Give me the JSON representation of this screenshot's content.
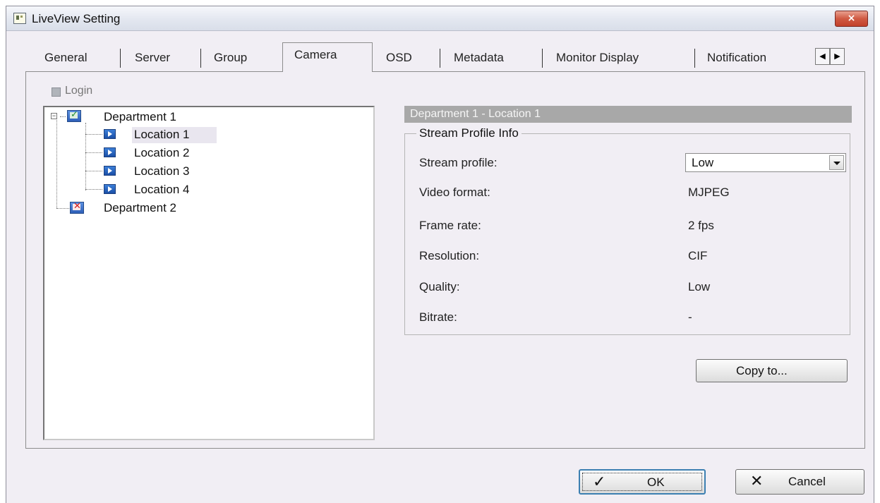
{
  "window": {
    "title": "LiveView Setting",
    "close_symbol": "×"
  },
  "tabs": [
    {
      "label": "General"
    },
    {
      "label": "Server"
    },
    {
      "label": "Group"
    },
    {
      "label": "Camera",
      "active": true
    },
    {
      "label": "OSD"
    },
    {
      "label": "Metadata"
    },
    {
      "label": "Monitor Display"
    },
    {
      "label": "Notification"
    }
  ],
  "tab_scroll": {
    "left": "◀",
    "right": "▶"
  },
  "login": {
    "label": "Login",
    "icon": "server-icon",
    "enabled": false
  },
  "tree": {
    "departments": [
      {
        "label": "Department 1",
        "status": "connected",
        "expanded": true,
        "locations": [
          {
            "label": "Location 1",
            "selected": true
          },
          {
            "label": "Location 2"
          },
          {
            "label": "Location 3"
          },
          {
            "label": "Location 4"
          }
        ]
      },
      {
        "label": "Department 2",
        "status": "disconnected",
        "expanded": false
      }
    ]
  },
  "detail": {
    "header": "Department 1 - Location 1",
    "group_title": "Stream Profile Info",
    "rows": [
      {
        "label": "Stream profile:",
        "value": "Low"
      },
      {
        "label": "Video format:",
        "value": "MJPEG"
      },
      {
        "label": "Frame rate:",
        "value": "2 fps"
      },
      {
        "label": "Resolution:",
        "value": "CIF"
      },
      {
        "label": "Quality:",
        "value": "Low"
      },
      {
        "label": "Bitrate:",
        "value": "-"
      }
    ],
    "copy_button": "Copy to..."
  },
  "footer": {
    "ok_label": "OK",
    "ok_icon": "checkmark-icon",
    "cancel_label": "Cancel",
    "cancel_icon": "x-icon"
  },
  "colors": {
    "window_bg": "#f1eef4",
    "header_bar": "#a8a8a8",
    "close_button": "#d05a43"
  }
}
